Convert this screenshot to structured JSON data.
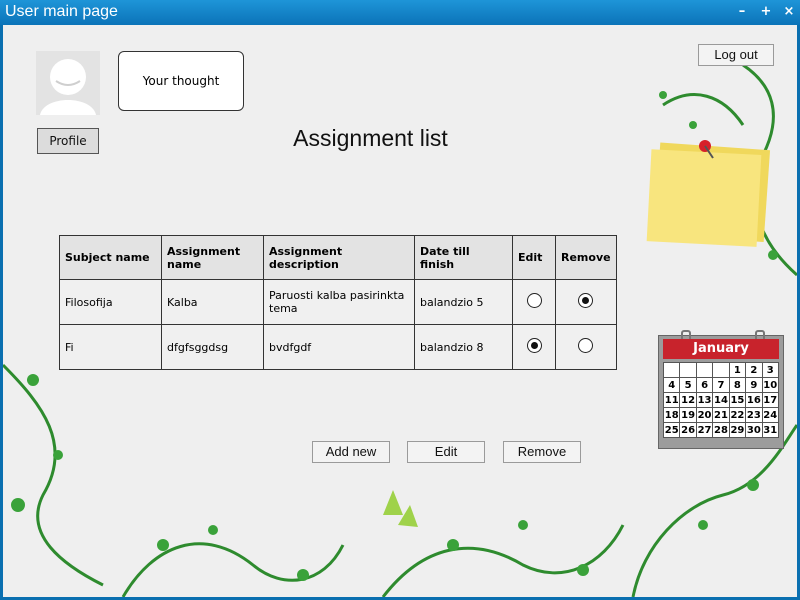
{
  "window": {
    "title": "User main page",
    "controls": [
      "–",
      "+",
      "×"
    ]
  },
  "profile": {
    "thought": "Your thought",
    "profile_label": "Profile"
  },
  "header": {
    "logout_label": "Log out",
    "page_title": "Assignment list"
  },
  "table": {
    "columns": [
      "Subject name",
      "Assignment name",
      "Assignment description",
      "Date till finish",
      "Edit",
      "Remove"
    ],
    "rows": [
      {
        "subject": "Filosofija",
        "assignment": "Kalba",
        "description": "Paruosti kalba pasirinkta tema",
        "date": "balandzio 5",
        "edit": false,
        "remove": true
      },
      {
        "subject": "Fi",
        "assignment": "dfgfsggdsg",
        "description": "bvdfgdf",
        "date": "balandzio 8",
        "edit": true,
        "remove": false
      }
    ]
  },
  "actions": {
    "add_new": "Add new",
    "edit": "Edit",
    "remove": "Remove"
  },
  "calendar": {
    "month": "January",
    "weeks": [
      [
        "",
        "",
        "",
        "",
        "1",
        "2",
        "3"
      ],
      [
        "4",
        "5",
        "6",
        "7",
        "8",
        "9",
        "10"
      ],
      [
        "11",
        "12",
        "13",
        "14",
        "15",
        "16",
        "17"
      ],
      [
        "18",
        "19",
        "20",
        "21",
        "22",
        "23",
        "24"
      ],
      [
        "25",
        "26",
        "27",
        "28",
        "29",
        "30",
        "31"
      ]
    ]
  },
  "colors": {
    "titlebar": "#0b73b8",
    "calendar_header": "#c8232c",
    "sticky_note": "#f5e27a",
    "floral": "#2e8b2e"
  }
}
